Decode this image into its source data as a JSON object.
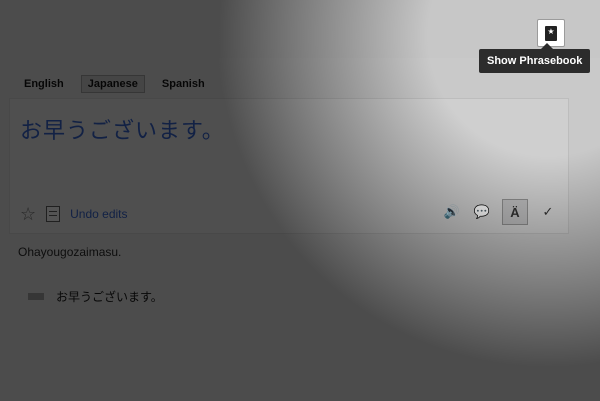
{
  "languages": [
    {
      "label": "English",
      "active": false
    },
    {
      "label": "Japanese",
      "active": true
    },
    {
      "label": "Spanish",
      "active": false
    }
  ],
  "source": {
    "text": "お早うございます。",
    "undo_label": "Undo edits"
  },
  "tools": {
    "speaker_icon": "🔊",
    "comment_icon": "💬",
    "script_label": "Ä",
    "check_icon": "✓"
  },
  "transliteration": "Ohayougozaimasu.",
  "result": {
    "text": "お早うございます。"
  },
  "phrasebook": {
    "tooltip": "Show Phrasebook",
    "icon": "★"
  }
}
